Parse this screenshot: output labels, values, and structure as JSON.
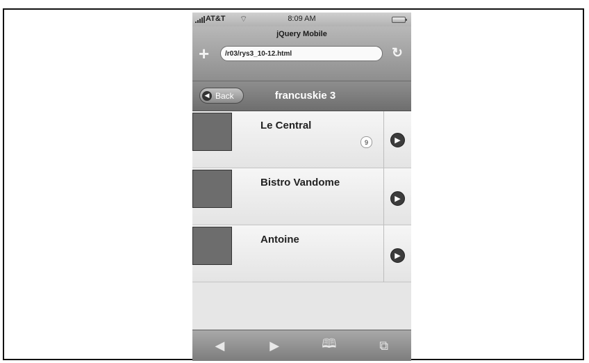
{
  "status": {
    "carrier": "AT&T",
    "time": "8:09 AM"
  },
  "browser": {
    "title": "jQuery Mobile",
    "url": "/r03/rys3_10-12.html",
    "plus_icon": "plus-icon",
    "reload_icon": "reload-icon"
  },
  "header": {
    "back_label": "Back",
    "title": "francuskie 3"
  },
  "list": [
    {
      "name": "Le Central",
      "count": "9"
    },
    {
      "name": "Bistro Vandome",
      "count": ""
    },
    {
      "name": "Antoine",
      "count": ""
    }
  ],
  "toolbar": [
    "back-icon",
    "forward-icon",
    "bookmarks-icon",
    "pages-icon"
  ]
}
